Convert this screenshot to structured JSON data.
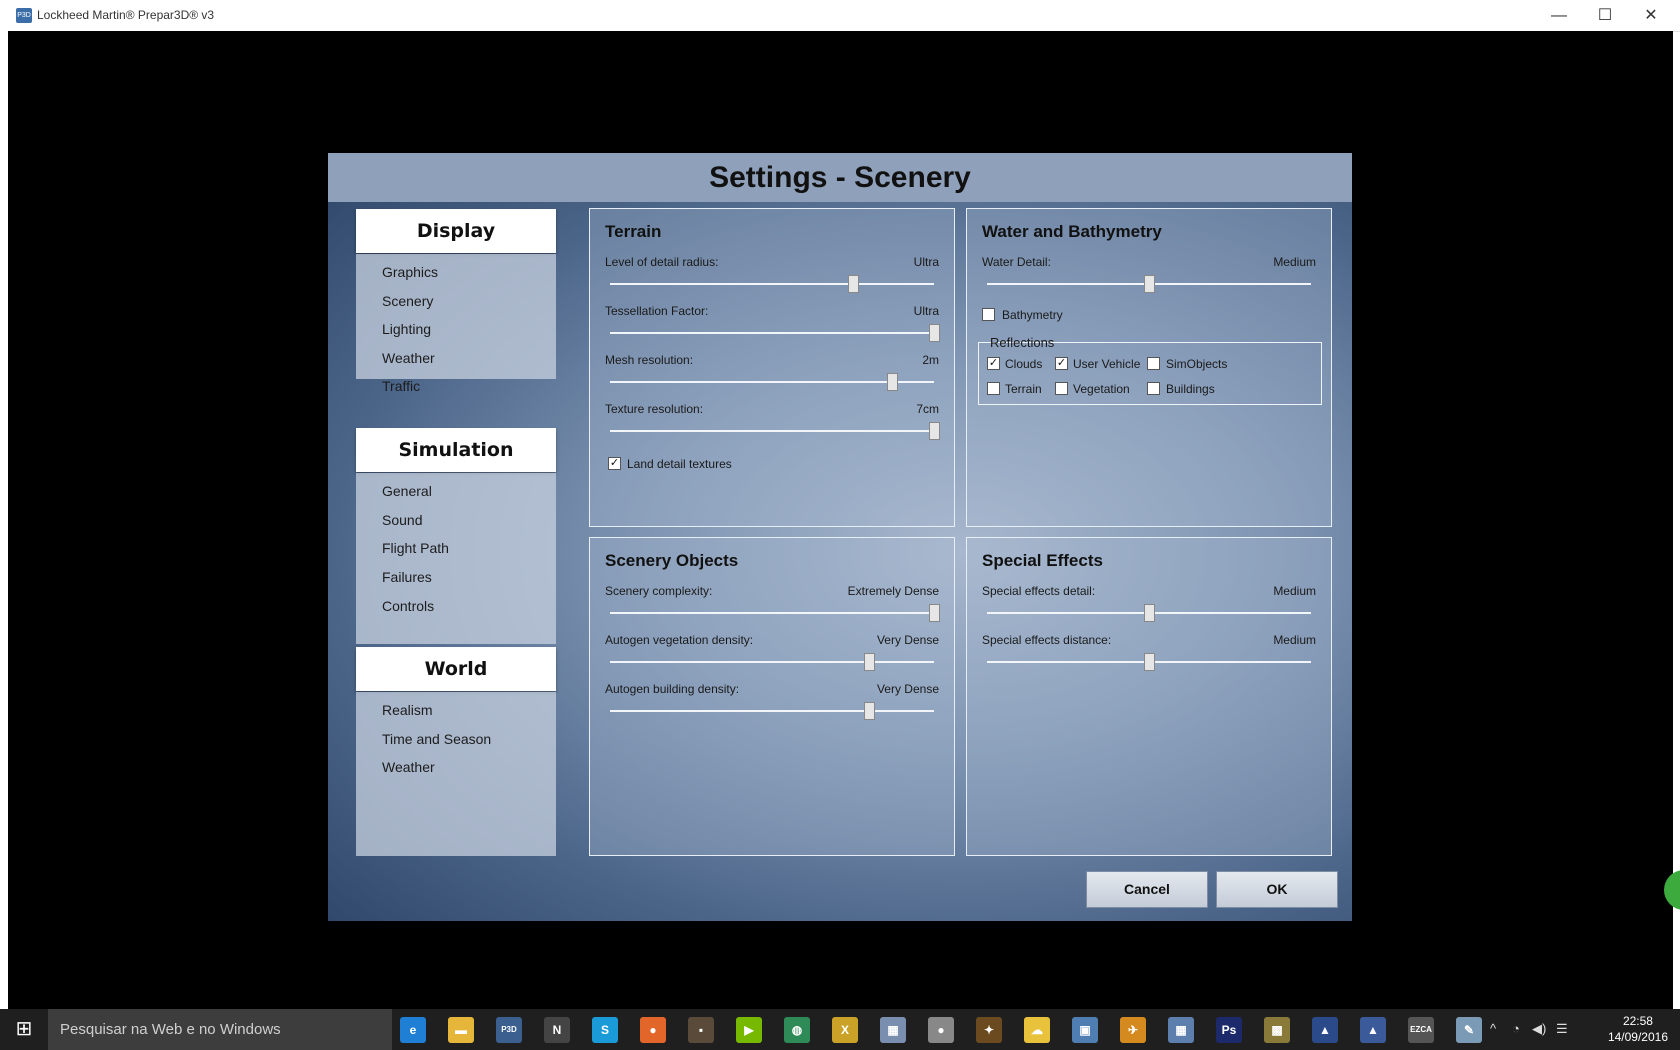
{
  "window": {
    "title": "Lockheed Martin® Prepar3D® v3",
    "app_icon": "P3D",
    "min_glyph": "—",
    "max_glyph": "☐",
    "close_glyph": "✕"
  },
  "dialog": {
    "title": "Settings - Scenery",
    "sidebar": {
      "sections": [
        {
          "heading": "Display",
          "items": [
            "Graphics",
            "Scenery",
            "Lighting",
            "Weather",
            "Traffic"
          ]
        },
        {
          "heading": "Simulation",
          "items": [
            "General",
            "Sound",
            "Flight Path",
            "Failures",
            "Controls"
          ]
        },
        {
          "heading": "World",
          "items": [
            "Realism",
            "Time and Season",
            "Weather"
          ]
        }
      ]
    },
    "terrain": {
      "title": "Terrain",
      "sliders": [
        {
          "label": "Level of detail radius:",
          "value": "Ultra",
          "level": 0.75
        },
        {
          "label": "Tessellation Factor:",
          "value": "Ultra",
          "level": 1.0
        },
        {
          "label": "Mesh resolution:",
          "value": "2m",
          "level": 0.87
        },
        {
          "label": "Texture resolution:",
          "value": "7cm",
          "level": 1.0
        }
      ],
      "land_detail": {
        "label": "Land detail textures",
        "checked": true
      }
    },
    "water": {
      "title": "Water and Bathymetry",
      "slider": {
        "label": "Water Detail:",
        "value": "Medium",
        "level": 0.5
      },
      "bathymetry": {
        "label": "Bathymetry",
        "checked": false
      },
      "reflections": {
        "label": "Reflections",
        "items": [
          {
            "label": "Clouds",
            "checked": true
          },
          {
            "label": "User Vehicle",
            "checked": true
          },
          {
            "label": "SimObjects",
            "checked": false
          },
          {
            "label": "Terrain",
            "checked": false
          },
          {
            "label": "Vegetation",
            "checked": false
          },
          {
            "label": "Buildings",
            "checked": false
          }
        ]
      }
    },
    "scenery_objects": {
      "title": "Scenery Objects",
      "sliders": [
        {
          "label": "Scenery complexity:",
          "value": "Extremely Dense",
          "level": 1.0
        },
        {
          "label": "Autogen vegetation density:",
          "value": "Very Dense",
          "level": 0.8
        },
        {
          "label": "Autogen building density:",
          "value": "Very Dense",
          "level": 0.8
        }
      ]
    },
    "special_effects": {
      "title": "Special Effects",
      "sliders": [
        {
          "label": "Special effects detail:",
          "value": "Medium",
          "level": 0.5
        },
        {
          "label": "Special effects distance:",
          "value": "Medium",
          "level": 0.5
        }
      ]
    },
    "buttons": {
      "cancel": "Cancel",
      "ok": "OK"
    }
  },
  "taskbar": {
    "search_placeholder": "Pesquisar na Web e no Windows",
    "apps": [
      {
        "name": "ie-icon",
        "glyph": "e",
        "color": "#1f7fd4"
      },
      {
        "name": "file-explorer-icon",
        "glyph": "▬",
        "color": "#e6b63a"
      },
      {
        "name": "p3d-icon",
        "glyph": "P3D",
        "color": "#3b5f8f"
      },
      {
        "name": "n-app-icon",
        "glyph": "N",
        "color": "#444444"
      },
      {
        "name": "skype-icon",
        "glyph": "S",
        "color": "#1a9ad6"
      },
      {
        "name": "firefox-icon",
        "glyph": "●",
        "color": "#e2662a"
      },
      {
        "name": "app-icon",
        "glyph": "▪",
        "color": "#5a4a3a"
      },
      {
        "name": "nvidia-icon",
        "glyph": "▶",
        "color": "#76b900"
      },
      {
        "name": "globe-icon",
        "glyph": "◍",
        "color": "#2e8b57"
      },
      {
        "name": "xplane-icon",
        "glyph": "X",
        "color": "#c9a227"
      },
      {
        "name": "app-icon",
        "glyph": "▦",
        "color": "#7a8fb0"
      },
      {
        "name": "sphere-icon",
        "glyph": "●",
        "color": "#888888"
      },
      {
        "name": "app-icon",
        "glyph": "✦",
        "color": "#6b4a1f"
      },
      {
        "name": "weather-icon",
        "glyph": "☁",
        "color": "#e8c23a"
      },
      {
        "name": "app-icon",
        "glyph": "▣",
        "color": "#4f7eb2"
      },
      {
        "name": "plane-icon",
        "glyph": "✈",
        "color": "#d48a1f"
      },
      {
        "name": "app-icon",
        "glyph": "▦",
        "color": "#5c7fae"
      },
      {
        "name": "photoshop-icon",
        "glyph": "Ps",
        "color": "#1c2a6b"
      },
      {
        "name": "app-icon",
        "glyph": "▩",
        "color": "#8a7a3a"
      },
      {
        "name": "app-icon",
        "glyph": "▲",
        "color": "#2a4a8a"
      },
      {
        "name": "app-icon",
        "glyph": "▲",
        "color": "#3a5a9a"
      },
      {
        "name": "ezca-icon",
        "glyph": "EZCA",
        "color": "#555555"
      },
      {
        "name": "paint-icon",
        "glyph": "✎",
        "color": "#7a9ab5"
      }
    ],
    "tray": {
      "chevron": "^",
      "network": "◔",
      "volume": "◀)",
      "message": "☰",
      "time": "22:58",
      "date": "14/09/2016"
    }
  }
}
